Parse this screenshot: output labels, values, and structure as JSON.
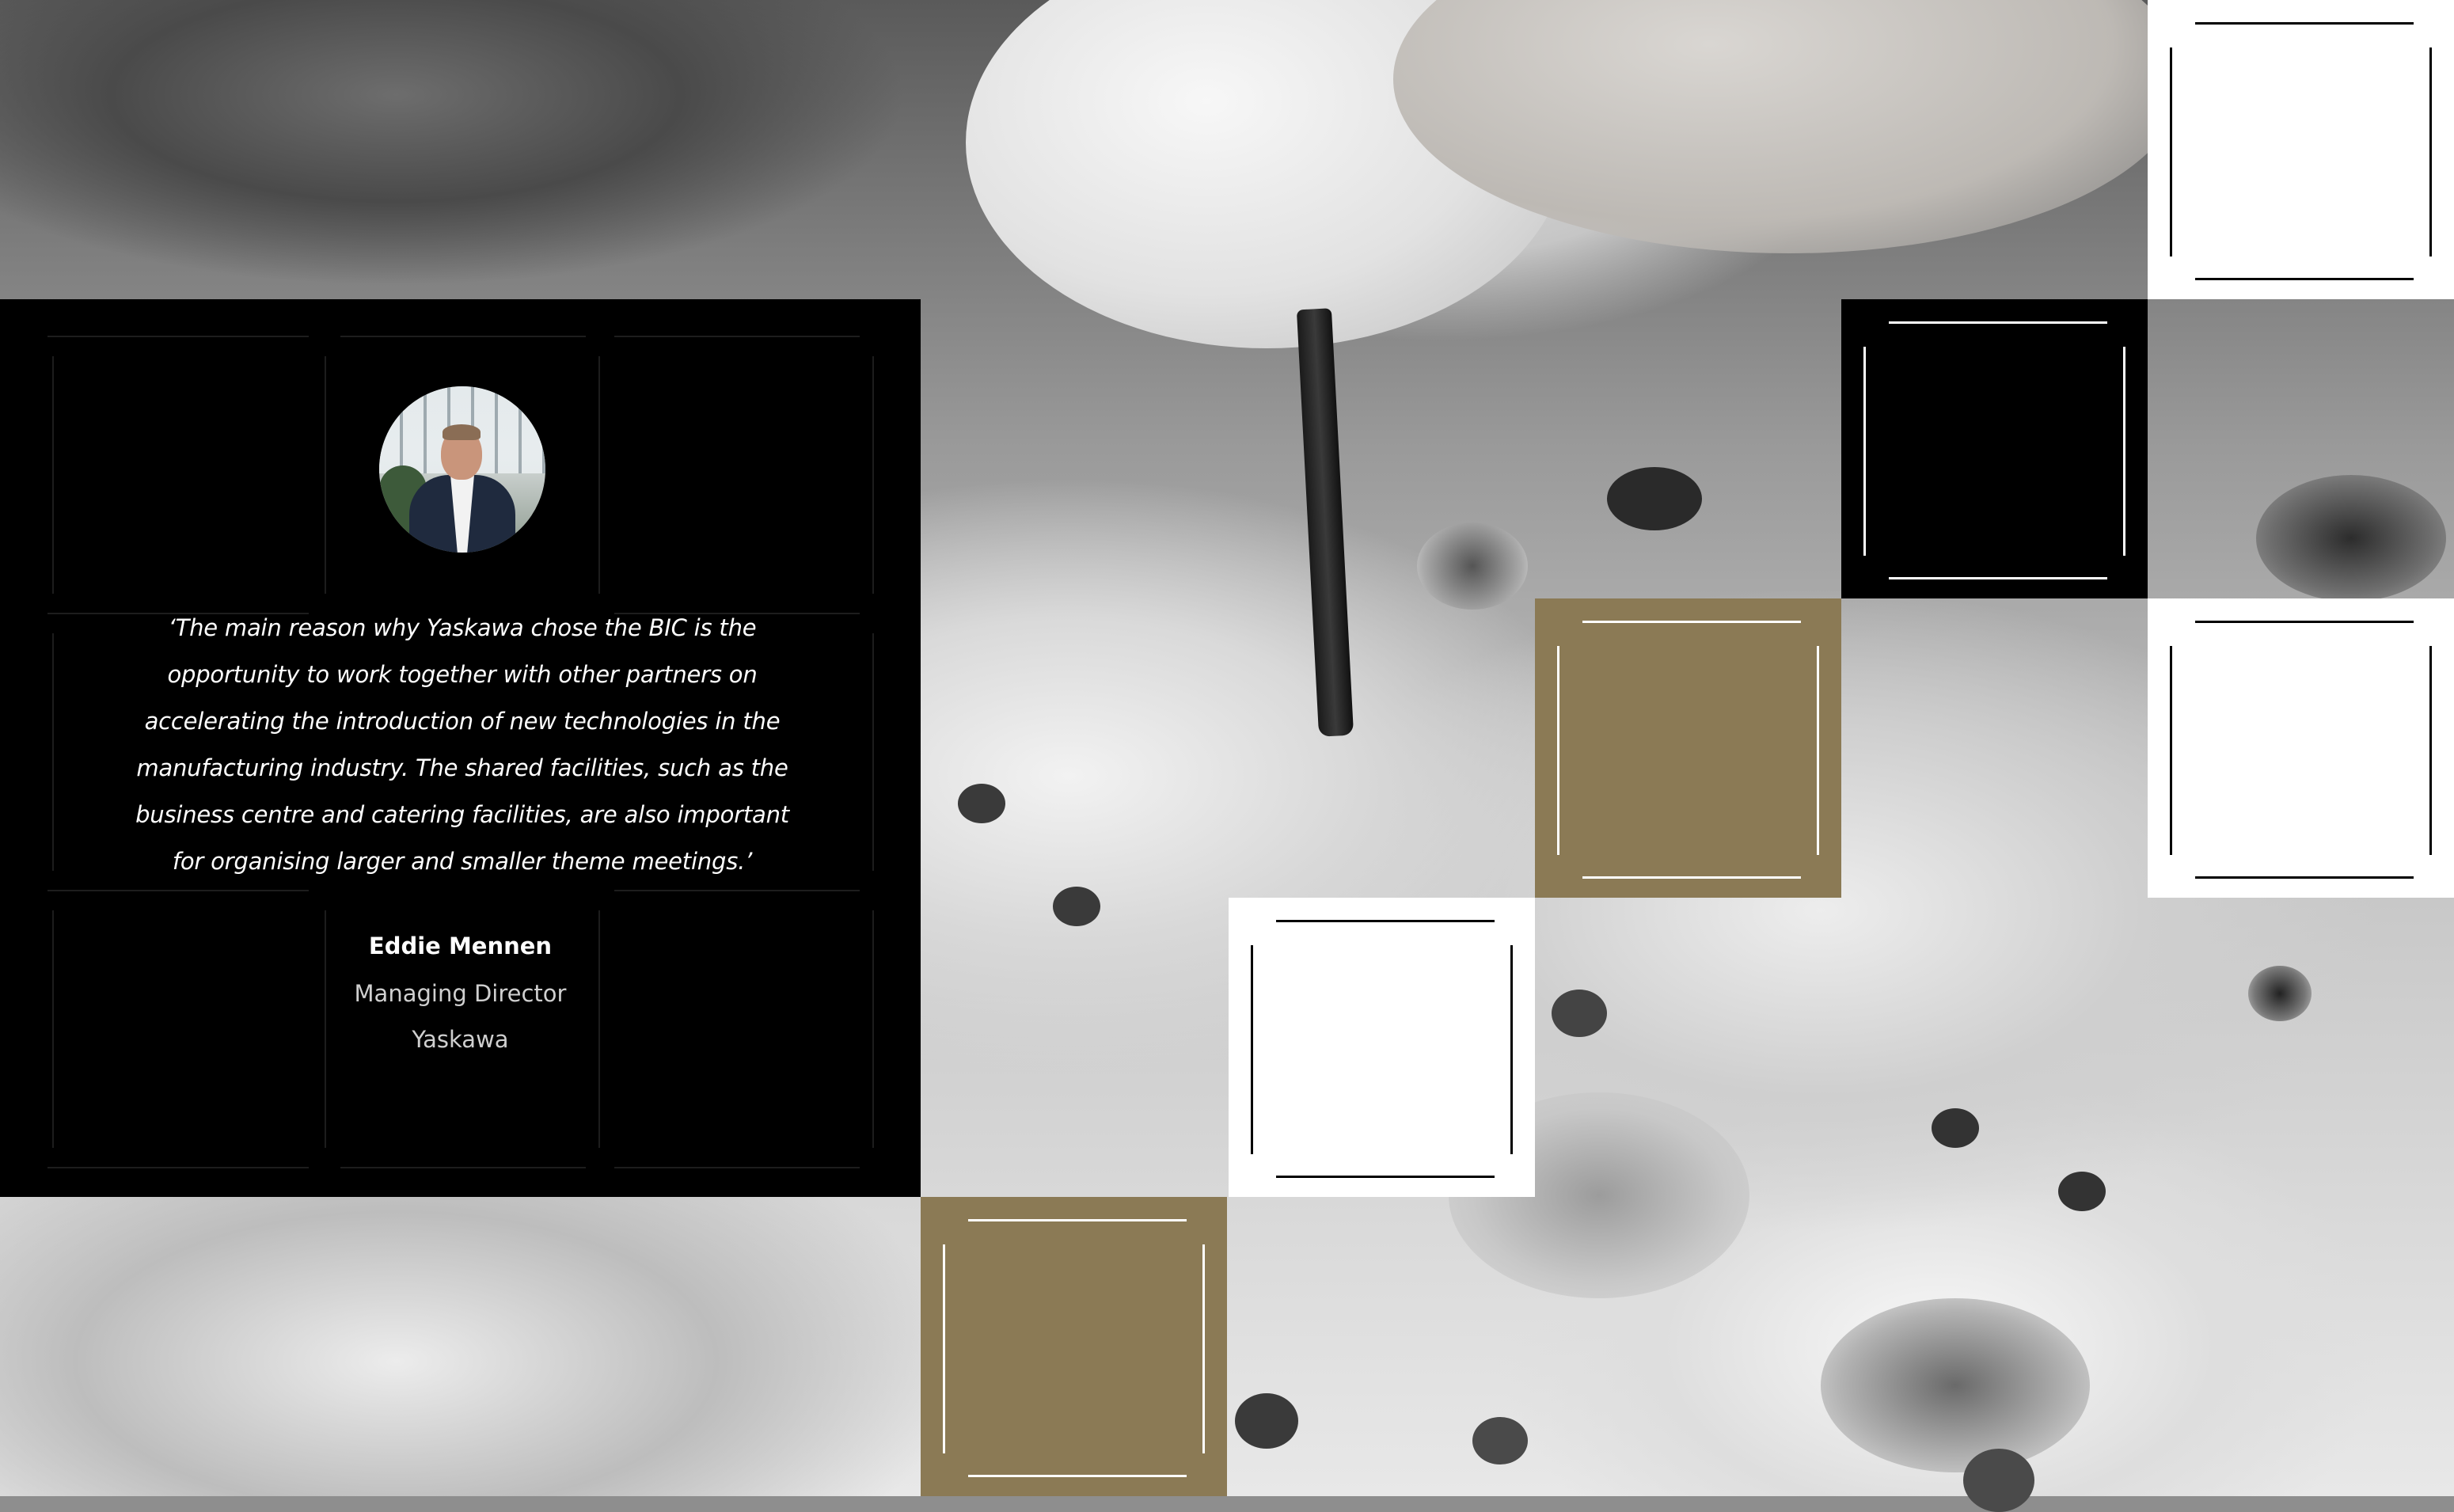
{
  "testimonial": {
    "quote": "‘The main reason why Yaskawa chose the BIC is the opportunity to work together with other partners on accelerating the introduction of new technologies in the manufacturing industry. The shared facilities, such as the business centre and catering facilities, are also important for organising larger and smaller theme meetings.’",
    "person_name": "Eddie Mennen",
    "person_title": "Managing Director",
    "company": "Yaskawa"
  },
  "colors": {
    "panel_background": "#000000",
    "accent_gold": "#8b7a55",
    "tile_white": "#ffffff"
  }
}
